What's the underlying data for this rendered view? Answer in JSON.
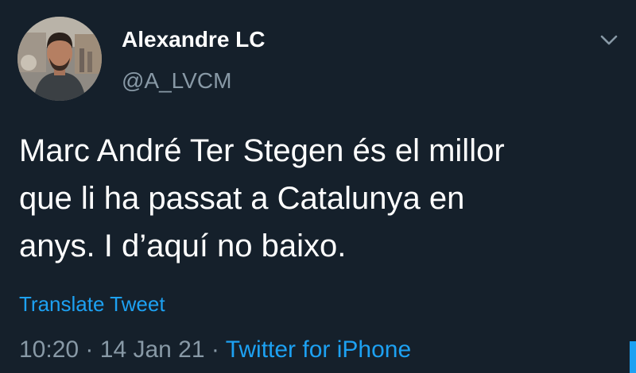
{
  "tweet": {
    "author": {
      "display_name": "Alexandre LC",
      "handle": "@A_LVCM",
      "avatar_icon": "profile-photo"
    },
    "menu_icon": "chevron-down-icon",
    "text_lines": [
      "Marc André Ter Stegen és el millor",
      "que li ha passat a Catalunya en",
      "anys. I d’aquí no baixo."
    ],
    "translate_label": "Translate Tweet",
    "time": "10:20",
    "separator": "·",
    "date": "14 Jan 21",
    "source": "Twitter for iPhone"
  },
  "colors": {
    "background": "#15202b",
    "primary_text": "#ffffff",
    "secondary_text": "#8899a6",
    "accent": "#1da1f2"
  }
}
